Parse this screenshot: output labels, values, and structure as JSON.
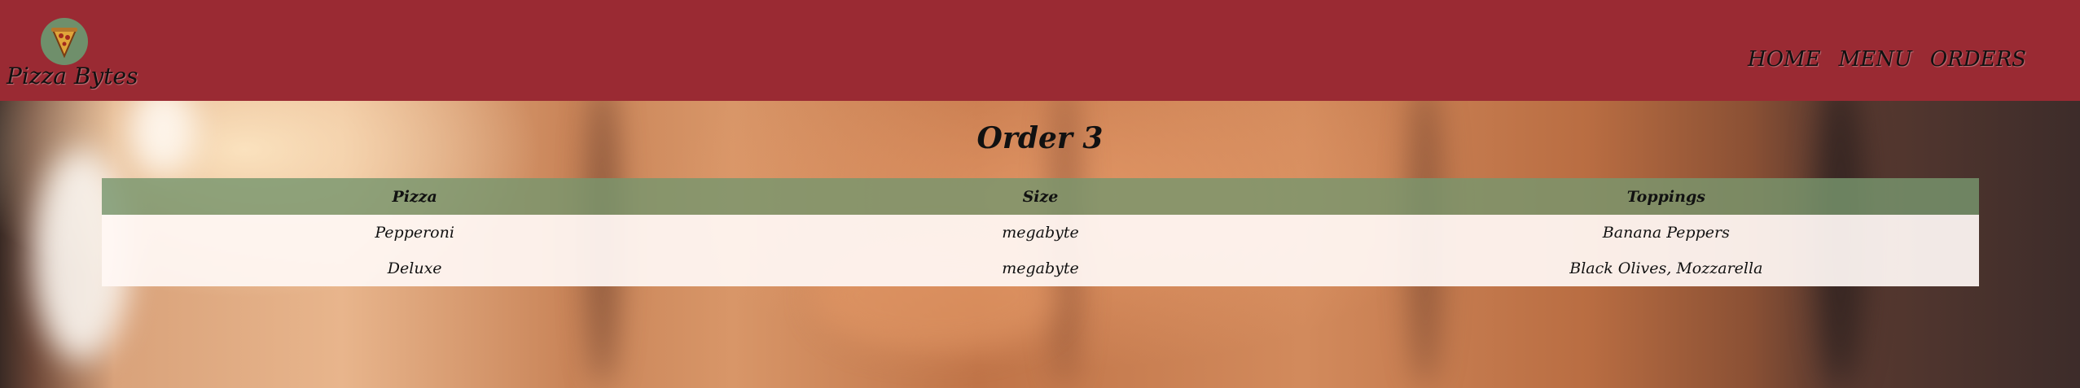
{
  "brand": {
    "name": "Pizza Bytes"
  },
  "nav": {
    "items": [
      {
        "label": "HOME"
      },
      {
        "label": "MENU"
      },
      {
        "label": "ORDERS"
      }
    ]
  },
  "page": {
    "title": "Order 3"
  },
  "order_table": {
    "columns": [
      "Pizza",
      "Size",
      "Toppings"
    ],
    "rows": [
      [
        "Pepperoni",
        "megabyte",
        "Banana Peppers"
      ],
      [
        "Deluxe",
        "megabyte",
        "Black Olives, Mozzarella"
      ]
    ]
  },
  "colors": {
    "header_bg": "#9a2a33",
    "table_header_bg": "#7a966e",
    "table_body_bg": "#fff8f4",
    "logo_bg": "#6f8f6b"
  }
}
